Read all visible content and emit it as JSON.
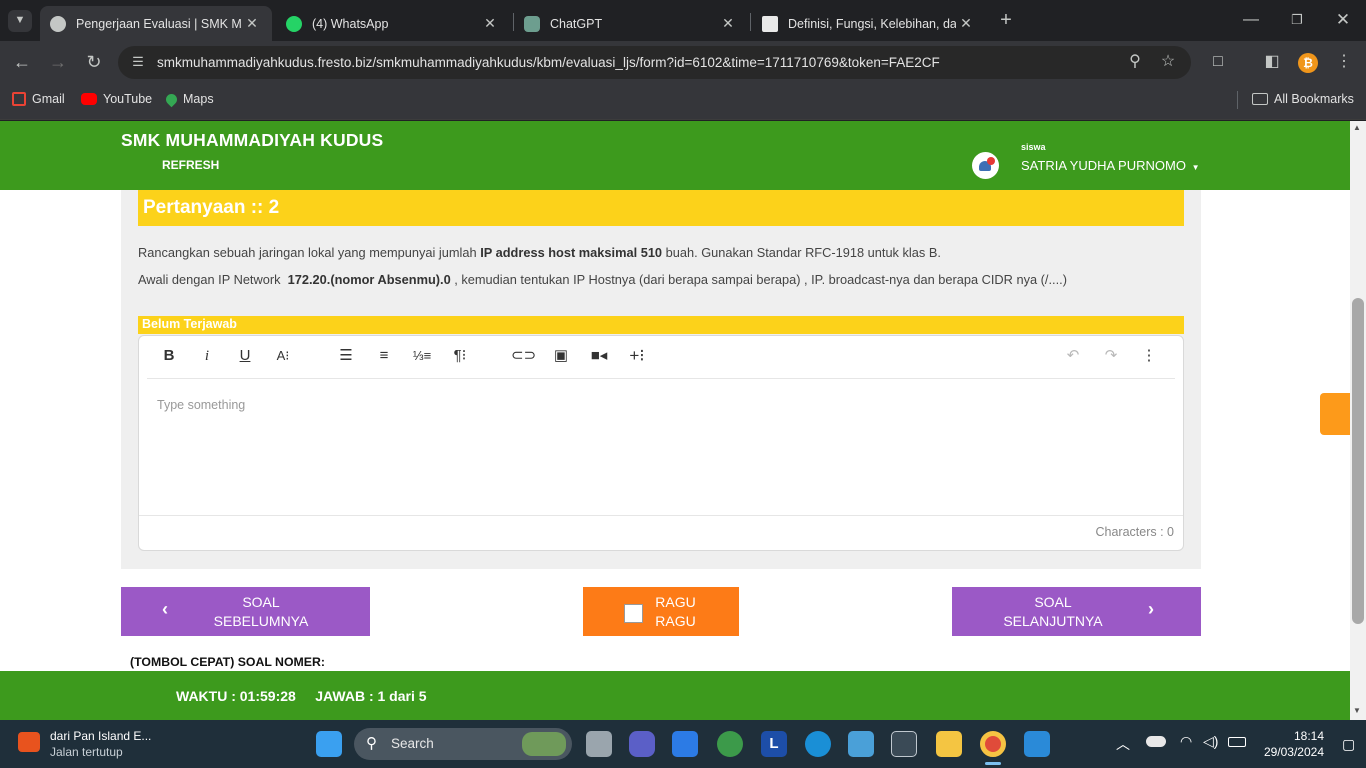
{
  "browser": {
    "tabs": [
      {
        "title": "Pengerjaan Evaluasi | SMK MUH",
        "active": true
      },
      {
        "title": "(4) WhatsApp",
        "active": false
      },
      {
        "title": "ChatGPT",
        "active": false
      },
      {
        "title": "Definisi, Fungsi, Kelebihan, dan",
        "active": false
      }
    ],
    "new_tab": "+",
    "address": "smkmuhammadiyahkudus.fresto.biz/smkmuhammadiyahkudus/kbm/evaluasi_ljs/form?id=6102&time=1711710769&token=FAE2CF",
    "bookmarks": [
      "Gmail",
      "YouTube",
      "Maps"
    ],
    "all_bookmarks": "All Bookmarks"
  },
  "site": {
    "title": "SMK MUHAMMADIYAH KUDUS",
    "refresh": "REFRESH",
    "user_role": "siswa",
    "user_name": "SATRIA YUDHA PURNOMO"
  },
  "question": {
    "heading": "Pertanyaan :: 2",
    "line1_pre": "Rancangkan sebuah jaringan lokal yang mempunyai jumlah ",
    "line1_bold": "IP address host maksimal 510",
    "line1_post": " buah. Gunakan Standar RFC-1918 untuk klas B.",
    "line2_pre": "Awali dengan IP Network  ",
    "line2_bold": "172.20.(nomor Absenmu).0",
    "line2_post": " , kemudian tentukan IP Hostnya (dari berapa sampai berapa) , IP. broadcast-nya dan berapa CIDR nya (/....)",
    "status": "Belum Terjawab"
  },
  "editor": {
    "placeholder": "Type something",
    "char_count": "Characters : 0"
  },
  "nav": {
    "prev_line1": "SOAL",
    "prev_line2": "SEBELUMNYA",
    "ragu_line1": "RAGU",
    "ragu_line2": "RAGU",
    "next_line1": "SOAL",
    "next_line2": "SELANJUTNYA"
  },
  "quick_jump_label": "(TOMBOL CEPAT) SOAL NOMER:",
  "footer": {
    "waktu": "WAKTU : 01:59:28",
    "jawab": "JAWAB : 1 dari 5"
  },
  "taskbar": {
    "weather_title": "dari Pan Island E...",
    "weather_sub": "Jalan tertutup",
    "search": "Search",
    "time": "18:14",
    "date": "29/03/2024"
  },
  "colors": {
    "header_green": "#3d9a1d",
    "heading_yellow": "#fcd21a",
    "nav_purple": "#9b59c6",
    "ragu_orange": "#fd7b17"
  }
}
